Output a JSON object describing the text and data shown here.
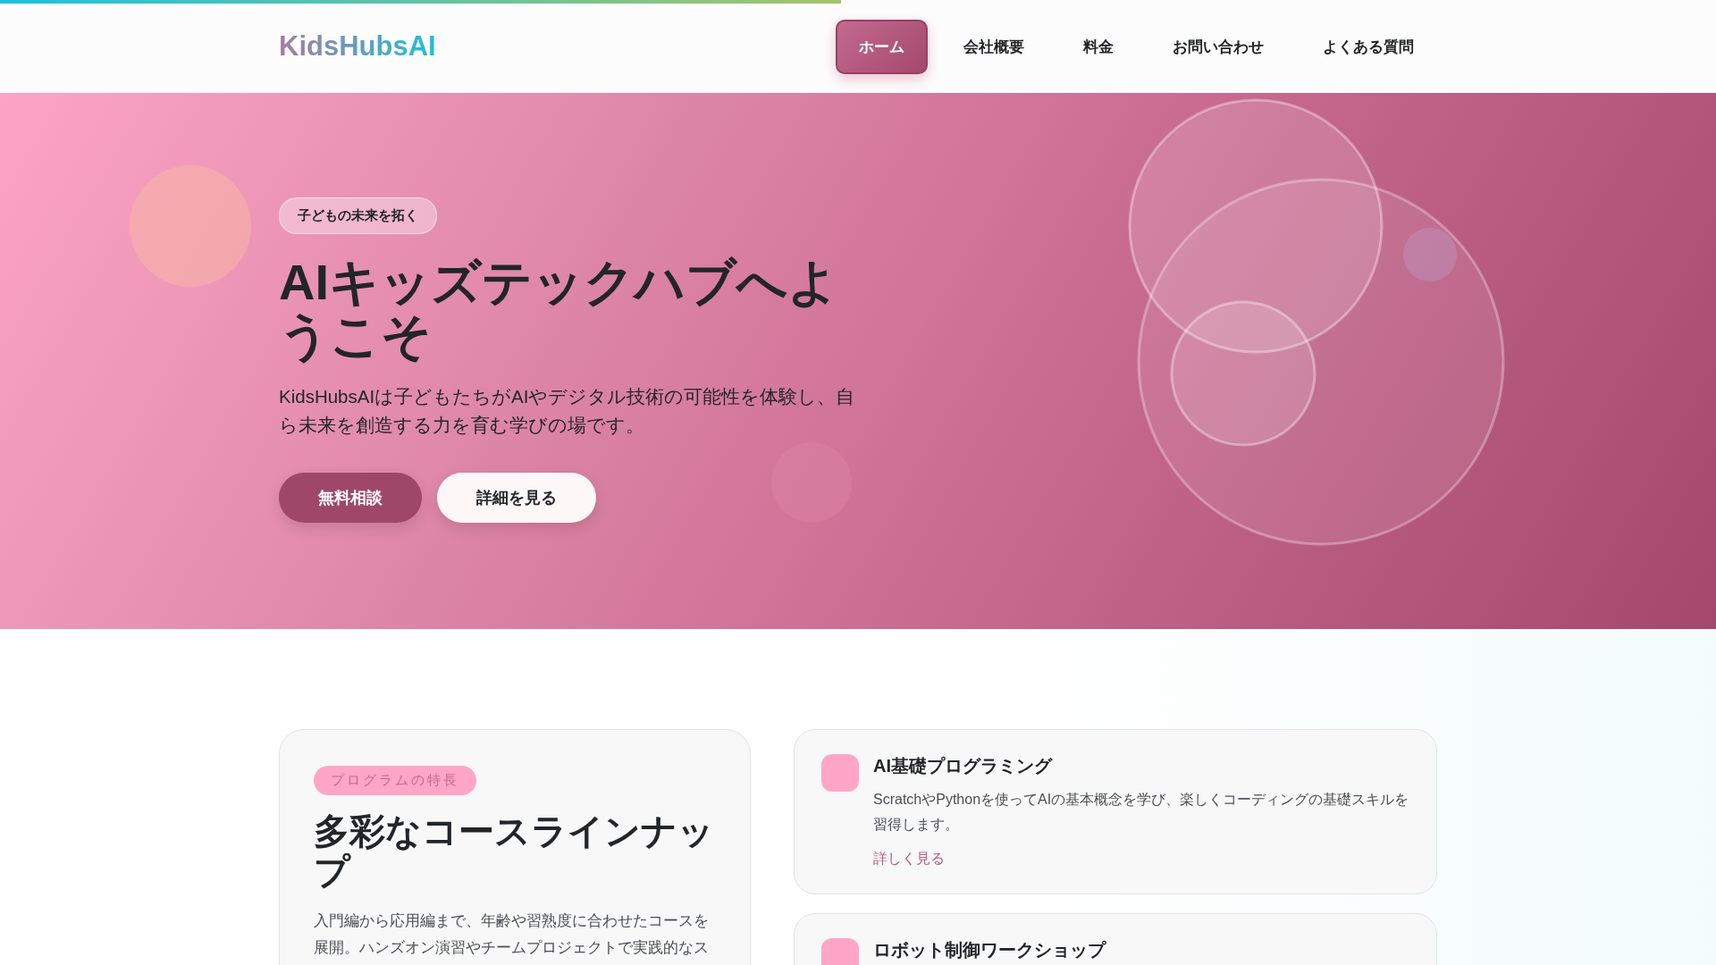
{
  "progress": {
    "level": 0.49
  },
  "header": {
    "logo": "KidsHubsAI",
    "nav": [
      {
        "label": "ホーム",
        "selected": true
      },
      {
        "label": "会社概要",
        "selected": false
      },
      {
        "label": "料金",
        "selected": false
      },
      {
        "label": "お問い合わせ",
        "selected": false
      },
      {
        "label": "よくある質問",
        "selected": false
      }
    ]
  },
  "hero": {
    "badge": "子どもの未来を拓く",
    "title": "AIキッズテックハブへようこそ",
    "text": "KidsHubsAIは子どもたちがAIやデジタル技術の可能性を体験し、自ら未来を創造する力を育む学びの場です。",
    "buttons": [
      {
        "label": "無料相談",
        "kind": "primary"
      },
      {
        "label": "詳細を見る",
        "kind": "secondary"
      }
    ]
  },
  "features": {
    "badge": "プログラムの特長",
    "title": "多彩なコースラインナップ",
    "text": "入門編から応用編まで、年齢や習熟度に合わせたコースを展開。ハンズオン演習やチームプロジェクトで実践的なス",
    "courses": [
      {
        "title": "AI基礎プログラミング",
        "text": "ScratchやPythonを使ってAIの基本概念を学び、楽しくコーディングの基礎スキルを習得します。",
        "link": "詳しく見る"
      },
      {
        "title": "ロボット制御ワークショップ"
      }
    ]
  }
}
